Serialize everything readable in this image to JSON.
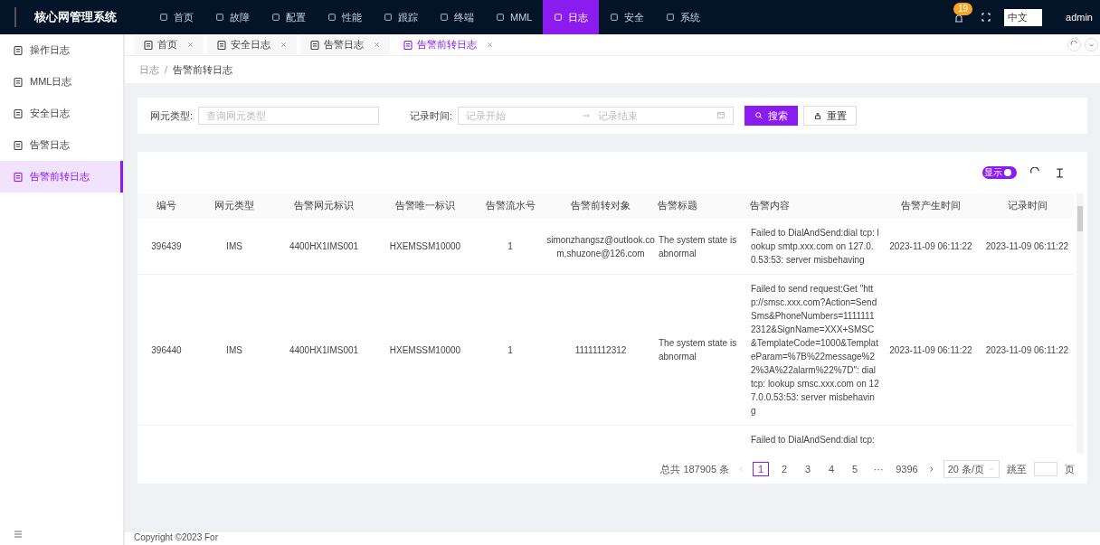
{
  "app_title": "核心网管理系统",
  "top_nav": [
    {
      "label": "首页",
      "selected": false
    },
    {
      "label": "故障",
      "selected": false
    },
    {
      "label": "配置",
      "selected": false
    },
    {
      "label": "性能",
      "selected": false
    },
    {
      "label": "跟踪",
      "selected": false
    },
    {
      "label": "终端",
      "selected": false
    },
    {
      "label": "MML",
      "selected": false
    },
    {
      "label": "日志",
      "selected": true
    },
    {
      "label": "安全",
      "selected": false
    },
    {
      "label": "系统",
      "selected": false
    }
  ],
  "notification_count": "19",
  "language": "中文",
  "user": "admin",
  "sidebar": {
    "items": [
      {
        "label": "操作日志",
        "selected": false
      },
      {
        "label": "MML日志",
        "selected": false
      },
      {
        "label": "安全日志",
        "selected": false
      },
      {
        "label": "告警日志",
        "selected": false
      },
      {
        "label": "告警前转日志",
        "selected": true
      }
    ]
  },
  "tabs": [
    {
      "label": "首页",
      "selected": false
    },
    {
      "label": "安全日志",
      "selected": false
    },
    {
      "label": "告警日志",
      "selected": false
    },
    {
      "label": "告警前转日志",
      "selected": true
    }
  ],
  "breadcrumb": {
    "items": [
      "日志",
      "告警前转日志"
    ],
    "separator": "/"
  },
  "search": {
    "ne_type_label": "网元类型:",
    "ne_type_placeholder": "查询网元类型",
    "time_label": "记录时间:",
    "start_placeholder": "记录开始",
    "end_placeholder": "记录结束",
    "search_button": "搜索",
    "reset_button": "重置"
  },
  "toolbar": {
    "toggle": {
      "label": "显示",
      "on": true
    }
  },
  "table": {
    "columns": [
      "编号",
      "网元类型",
      "告警网元标识",
      "告警唯一标识",
      "告警流水号",
      "告警前转对象",
      "告警标题",
      "告警内容",
      "告警产生时间",
      "记录时间"
    ],
    "rows": [
      [
        "396439",
        "IMS",
        "4400HX1IMS001",
        "HXEMSSM10000",
        "1",
        "simonzhangsz@outlook.com,shuzone@126.com",
        "The system state is abnormal",
        "Failed to DialAndSend:dial tcp: lookup smtp.xxx.com on 127.0.0.53:53: server misbehaving",
        "2023-11-09 06:11:22",
        "2023-11-09 06:11:22"
      ],
      [
        "396440",
        "IMS",
        "4400HX1IMS001",
        "HXEMSSM10000",
        "1",
        "11111112312",
        "The system state is abnormal",
        "Failed to send request:Get \"http://smsc.xxx.com?Action=SendSms&PhoneNumbers=11111112312&SignName=XXX+SMSC&TemplateCode=1000&TemplateParam=%7B%22message%22%3A%22alarm%22%7D\": dial tcp: lookup smsc.xxx.com on 127.0.0.53:53: server misbehaving",
        "2023-11-09 06:11:22",
        "2023-11-09 06:11:22"
      ],
      [
        "",
        "",
        "",
        "",
        "",
        "",
        "",
        "Failed to DialAndSend:dial tcp:",
        "",
        ""
      ]
    ]
  },
  "pagination": {
    "total": "总共 187905 条",
    "pages": [
      {
        "label": "1",
        "selected": true
      },
      {
        "label": "2",
        "selected": false
      },
      {
        "label": "3",
        "selected": false
      },
      {
        "label": "4",
        "selected": false
      },
      {
        "label": "5",
        "selected": false
      },
      {
        "label": "···",
        "selected": false
      },
      {
        "label": "9396",
        "selected": false
      }
    ],
    "page_size": "20 条/页",
    "jump_label": "跳至",
    "page_unit": "页"
  },
  "footer": "Copyright ©2023 For"
}
